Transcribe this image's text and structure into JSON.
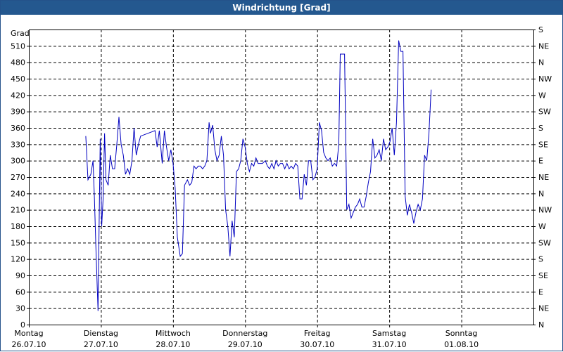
{
  "window": {
    "title": "Windrichtung [Grad]"
  },
  "chart_data": {
    "type": "line",
    "title": "Windrichtung [Grad]",
    "ylabel": "Grad",
    "ylim": [
      0,
      540
    ],
    "grid": true,
    "yticks": [
      0,
      30,
      60,
      90,
      120,
      150,
      180,
      210,
      240,
      270,
      300,
      330,
      360,
      390,
      420,
      450,
      480,
      510
    ],
    "ytick_labels": [
      "0",
      "30",
      "60",
      "90",
      "120",
      "150",
      "180",
      "210",
      "240",
      "270",
      "300",
      "330",
      "360",
      "390",
      "420",
      "450",
      "480",
      "510"
    ],
    "y2ticks": [
      0,
      30,
      60,
      90,
      120,
      150,
      180,
      210,
      240,
      270,
      300,
      330,
      360,
      390,
      420,
      450,
      480,
      510,
      540
    ],
    "y2tick_labels": [
      "N",
      "NE",
      "E",
      "SE",
      "S",
      "SW",
      "W",
      "NW",
      "N",
      "NE",
      "E",
      "SE",
      "S",
      "SW",
      "W",
      "NW",
      "N",
      "NE",
      "S"
    ],
    "xlim": [
      0,
      7
    ],
    "xticks": [
      0,
      1,
      2,
      3,
      4,
      5,
      6
    ],
    "xtick_labels": [
      {
        "day": "Montag",
        "date": "26.07.10"
      },
      {
        "day": "Dienstag",
        "date": "27.07.10"
      },
      {
        "day": "Mittwoch",
        "date": "28.07.10"
      },
      {
        "day": "Donnerstag",
        "date": "29.07.10"
      },
      {
        "day": "Freitag",
        "date": "30.07.10"
      },
      {
        "day": "Samstag",
        "date": "31.07.10"
      },
      {
        "day": "Sonntag",
        "date": "01.08.10"
      }
    ],
    "series": [
      {
        "color": "#0000c0",
        "points": [
          [
            0.79,
            345
          ],
          [
            0.82,
            265
          ],
          [
            0.86,
            275
          ],
          [
            0.89,
            300
          ],
          [
            0.91,
            230
          ],
          [
            0.93,
            140
          ],
          [
            0.96,
            25
          ],
          [
            0.99,
            340
          ],
          [
            1.01,
            180
          ],
          [
            1.03,
            230
          ],
          [
            1.05,
            350
          ],
          [
            1.07,
            265
          ],
          [
            1.1,
            255
          ],
          [
            1.13,
            310
          ],
          [
            1.16,
            285
          ],
          [
            1.19,
            285
          ],
          [
            1.22,
            330
          ],
          [
            1.25,
            380
          ],
          [
            1.28,
            330
          ],
          [
            1.31,
            310
          ],
          [
            1.34,
            275
          ],
          [
            1.37,
            285
          ],
          [
            1.4,
            275
          ],
          [
            1.43,
            300
          ],
          [
            1.46,
            360
          ],
          [
            1.49,
            310
          ],
          [
            1.52,
            330
          ],
          [
            1.55,
            345
          ],
          [
            1.75,
            355
          ],
          [
            1.78,
            325
          ],
          [
            1.81,
            355
          ],
          [
            1.85,
            295
          ],
          [
            1.88,
            355
          ],
          [
            1.91,
            325
          ],
          [
            1.94,
            300
          ],
          [
            1.97,
            320
          ],
          [
            2.0,
            295
          ],
          [
            2.03,
            250
          ],
          [
            2.06,
            160
          ],
          [
            2.1,
            125
          ],
          [
            2.13,
            130
          ],
          [
            2.16,
            255
          ],
          [
            2.2,
            265
          ],
          [
            2.23,
            255
          ],
          [
            2.26,
            260
          ],
          [
            2.29,
            290
          ],
          [
            2.32,
            285
          ],
          [
            2.35,
            290
          ],
          [
            2.38,
            290
          ],
          [
            2.41,
            285
          ],
          [
            2.44,
            290
          ],
          [
            2.47,
            300
          ],
          [
            2.5,
            370
          ],
          [
            2.52,
            350
          ],
          [
            2.55,
            365
          ],
          [
            2.58,
            320
          ],
          [
            2.61,
            300
          ],
          [
            2.64,
            310
          ],
          [
            2.67,
            345
          ],
          [
            2.7,
            310
          ],
          [
            2.73,
            210
          ],
          [
            2.76,
            180
          ],
          [
            2.79,
            125
          ],
          [
            2.82,
            190
          ],
          [
            2.85,
            160
          ],
          [
            2.88,
            280
          ],
          [
            2.91,
            285
          ],
          [
            2.94,
            300
          ],
          [
            2.97,
            340
          ],
          [
            3.0,
            325
          ],
          [
            3.03,
            295
          ],
          [
            3.06,
            280
          ],
          [
            3.09,
            295
          ],
          [
            3.12,
            290
          ],
          [
            3.15,
            305
          ],
          [
            3.18,
            295
          ],
          [
            3.21,
            295
          ],
          [
            3.24,
            295
          ],
          [
            3.28,
            300
          ],
          [
            3.31,
            290
          ],
          [
            3.34,
            285
          ],
          [
            3.37,
            295
          ],
          [
            3.4,
            285
          ],
          [
            3.43,
            300
          ],
          [
            3.46,
            290
          ],
          [
            3.49,
            295
          ],
          [
            3.52,
            295
          ],
          [
            3.55,
            285
          ],
          [
            3.58,
            295
          ],
          [
            3.61,
            285
          ],
          [
            3.64,
            290
          ],
          [
            3.67,
            285
          ],
          [
            3.7,
            295
          ],
          [
            3.73,
            290
          ],
          [
            3.76,
            230
          ],
          [
            3.79,
            230
          ],
          [
            3.82,
            275
          ],
          [
            3.85,
            255
          ],
          [
            3.88,
            300
          ],
          [
            3.91,
            300
          ],
          [
            3.94,
            265
          ],
          [
            3.97,
            270
          ],
          [
            4.0,
            285
          ],
          [
            4.03,
            370
          ],
          [
            4.06,
            355
          ],
          [
            4.09,
            315
          ],
          [
            4.12,
            305
          ],
          [
            4.15,
            300
          ],
          [
            4.18,
            305
          ],
          [
            4.21,
            290
          ],
          [
            4.24,
            295
          ],
          [
            4.27,
            290
          ],
          [
            4.3,
            330
          ],
          [
            4.32,
            495
          ],
          [
            4.38,
            495
          ],
          [
            4.41,
            210
          ],
          [
            4.44,
            220
          ],
          [
            4.47,
            195
          ],
          [
            4.5,
            205
          ],
          [
            4.53,
            215
          ],
          [
            4.56,
            220
          ],
          [
            4.59,
            230
          ],
          [
            4.62,
            215
          ],
          [
            4.65,
            215
          ],
          [
            4.68,
            235
          ],
          [
            4.71,
            260
          ],
          [
            4.74,
            280
          ],
          [
            4.77,
            340
          ],
          [
            4.8,
            305
          ],
          [
            4.83,
            310
          ],
          [
            4.86,
            320
          ],
          [
            4.89,
            300
          ],
          [
            4.92,
            340
          ],
          [
            4.95,
            320
          ],
          [
            4.98,
            325
          ],
          [
            5.01,
            335
          ],
          [
            5.04,
            360
          ],
          [
            5.07,
            310
          ],
          [
            5.1,
            370
          ],
          [
            5.13,
            520
          ],
          [
            5.16,
            500
          ],
          [
            5.19,
            500
          ],
          [
            5.22,
            235
          ],
          [
            5.25,
            200
          ],
          [
            5.28,
            220
          ],
          [
            5.31,
            205
          ],
          [
            5.34,
            185
          ],
          [
            5.37,
            205
          ],
          [
            5.4,
            220
          ],
          [
            5.43,
            210
          ],
          [
            5.46,
            230
          ],
          [
            5.49,
            310
          ],
          [
            5.52,
            300
          ],
          [
            5.55,
            350
          ],
          [
            5.58,
            430
          ]
        ]
      }
    ]
  }
}
